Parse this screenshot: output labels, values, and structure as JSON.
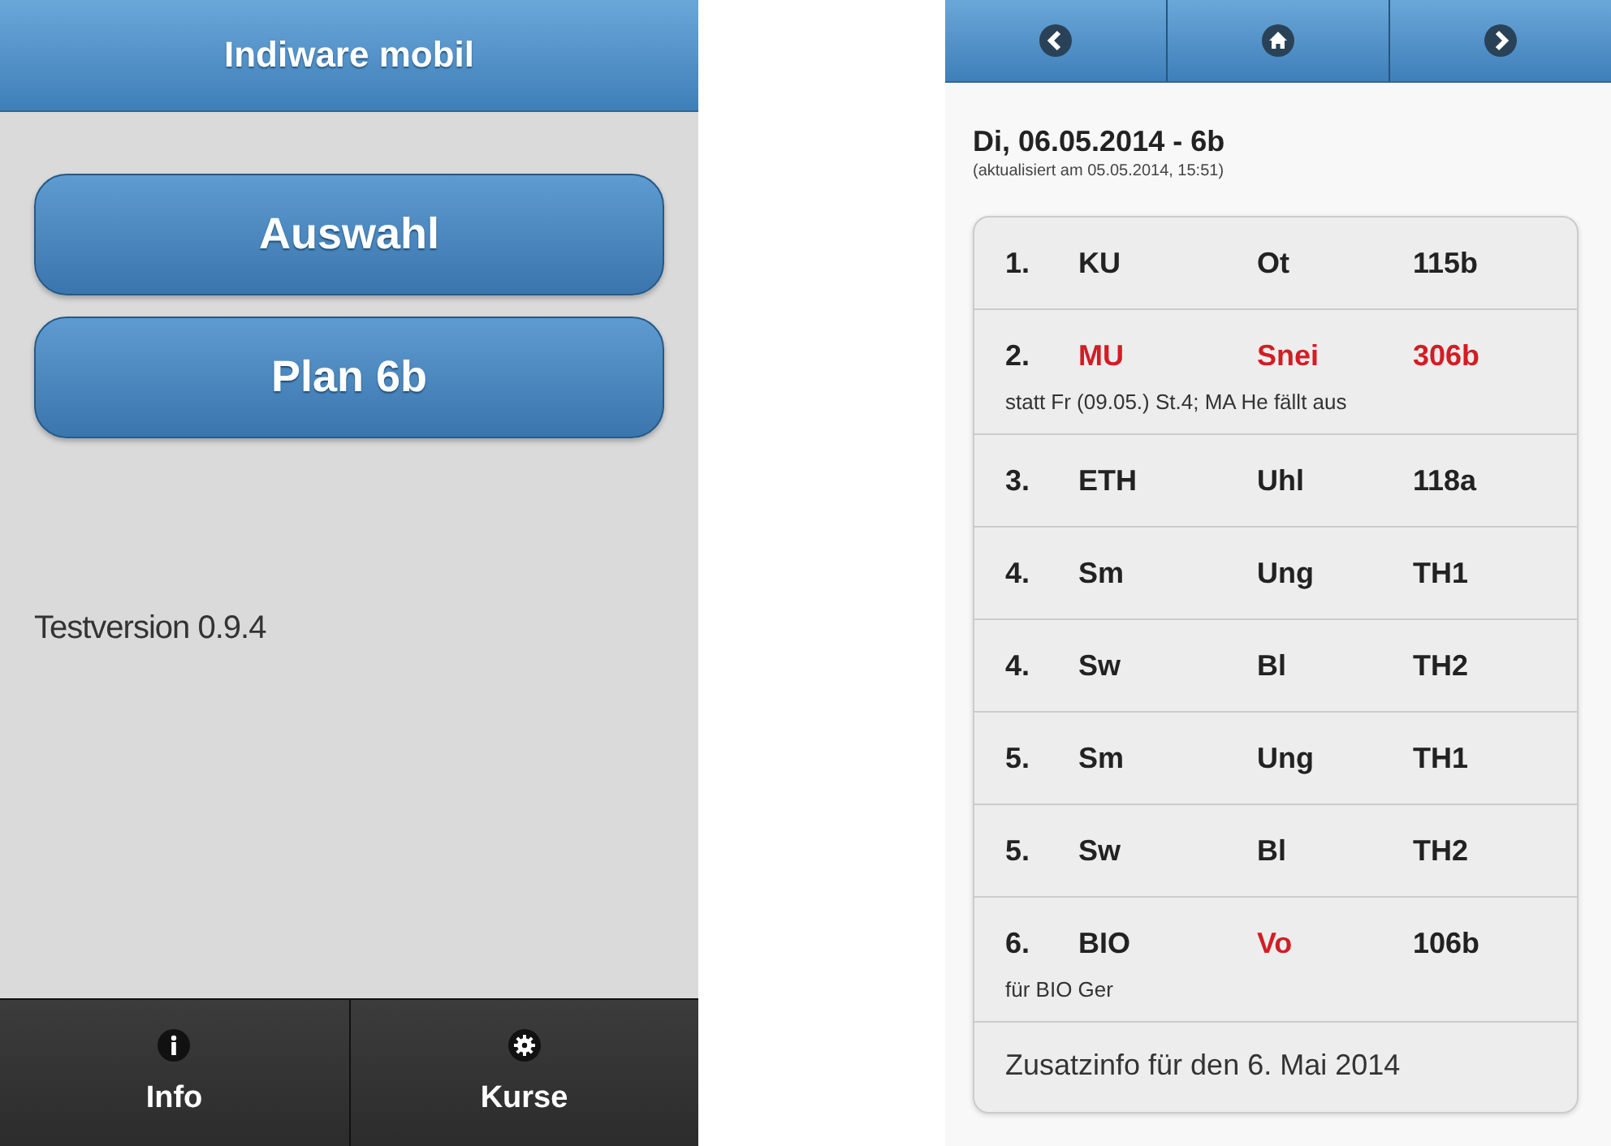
{
  "menu_screen": {
    "title": "Indiware mobil",
    "buttons": [
      "Auswahl",
      "Plan 6b"
    ],
    "version": "Testversion 0.9.4",
    "footer_tabs": [
      {
        "label": "Info",
        "kind": "info"
      },
      {
        "label": "Kurse",
        "kind": "gear"
      }
    ]
  },
  "plan_screen": {
    "nav_buttons": [
      {
        "kind": "back"
      },
      {
        "kind": "home"
      },
      {
        "kind": "forward"
      }
    ],
    "heading": "Di, 06.05.2014 - 6b",
    "updated": "(aktualisiert am 05.05.2014, 15:51)",
    "lessons": [
      {
        "hour": "1.",
        "subject": {
          "text": "KU",
          "changed": false
        },
        "teacher": {
          "text": "Ot",
          "changed": false
        },
        "room": {
          "text": "115b",
          "changed": false
        }
      },
      {
        "hour": "2.",
        "subject": {
          "text": "MU",
          "changed": true
        },
        "teacher": {
          "text": "Snei",
          "changed": true
        },
        "room": {
          "text": "306b",
          "changed": true
        },
        "note": "statt Fr (09.05.) St.4; MA He fällt aus"
      },
      {
        "hour": "3.",
        "subject": {
          "text": "ETH",
          "changed": false
        },
        "teacher": {
          "text": "Uhl",
          "changed": false
        },
        "room": {
          "text": "118a",
          "changed": false
        }
      },
      {
        "hour": "4.",
        "subject": {
          "text": "Sm",
          "changed": false
        },
        "teacher": {
          "text": "Ung",
          "changed": false
        },
        "room": {
          "text": "TH1",
          "changed": false
        }
      },
      {
        "hour": "4.",
        "subject": {
          "text": "Sw",
          "changed": false
        },
        "teacher": {
          "text": "Bl",
          "changed": false
        },
        "room": {
          "text": "TH2",
          "changed": false
        }
      },
      {
        "hour": "5.",
        "subject": {
          "text": "Sm",
          "changed": false
        },
        "teacher": {
          "text": "Ung",
          "changed": false
        },
        "room": {
          "text": "TH1",
          "changed": false
        }
      },
      {
        "hour": "5.",
        "subject": {
          "text": "Sw",
          "changed": false
        },
        "teacher": {
          "text": "Bl",
          "changed": false
        },
        "room": {
          "text": "TH2",
          "changed": false
        }
      },
      {
        "hour": "6.",
        "subject": {
          "text": "BIO",
          "changed": false
        },
        "teacher": {
          "text": "Vo",
          "changed": true
        },
        "room": {
          "text": "106b",
          "changed": false
        },
        "note": "für BIO Ger"
      }
    ],
    "extra_info": "Zusatzinfo für den 6. Mai 2014"
  }
}
